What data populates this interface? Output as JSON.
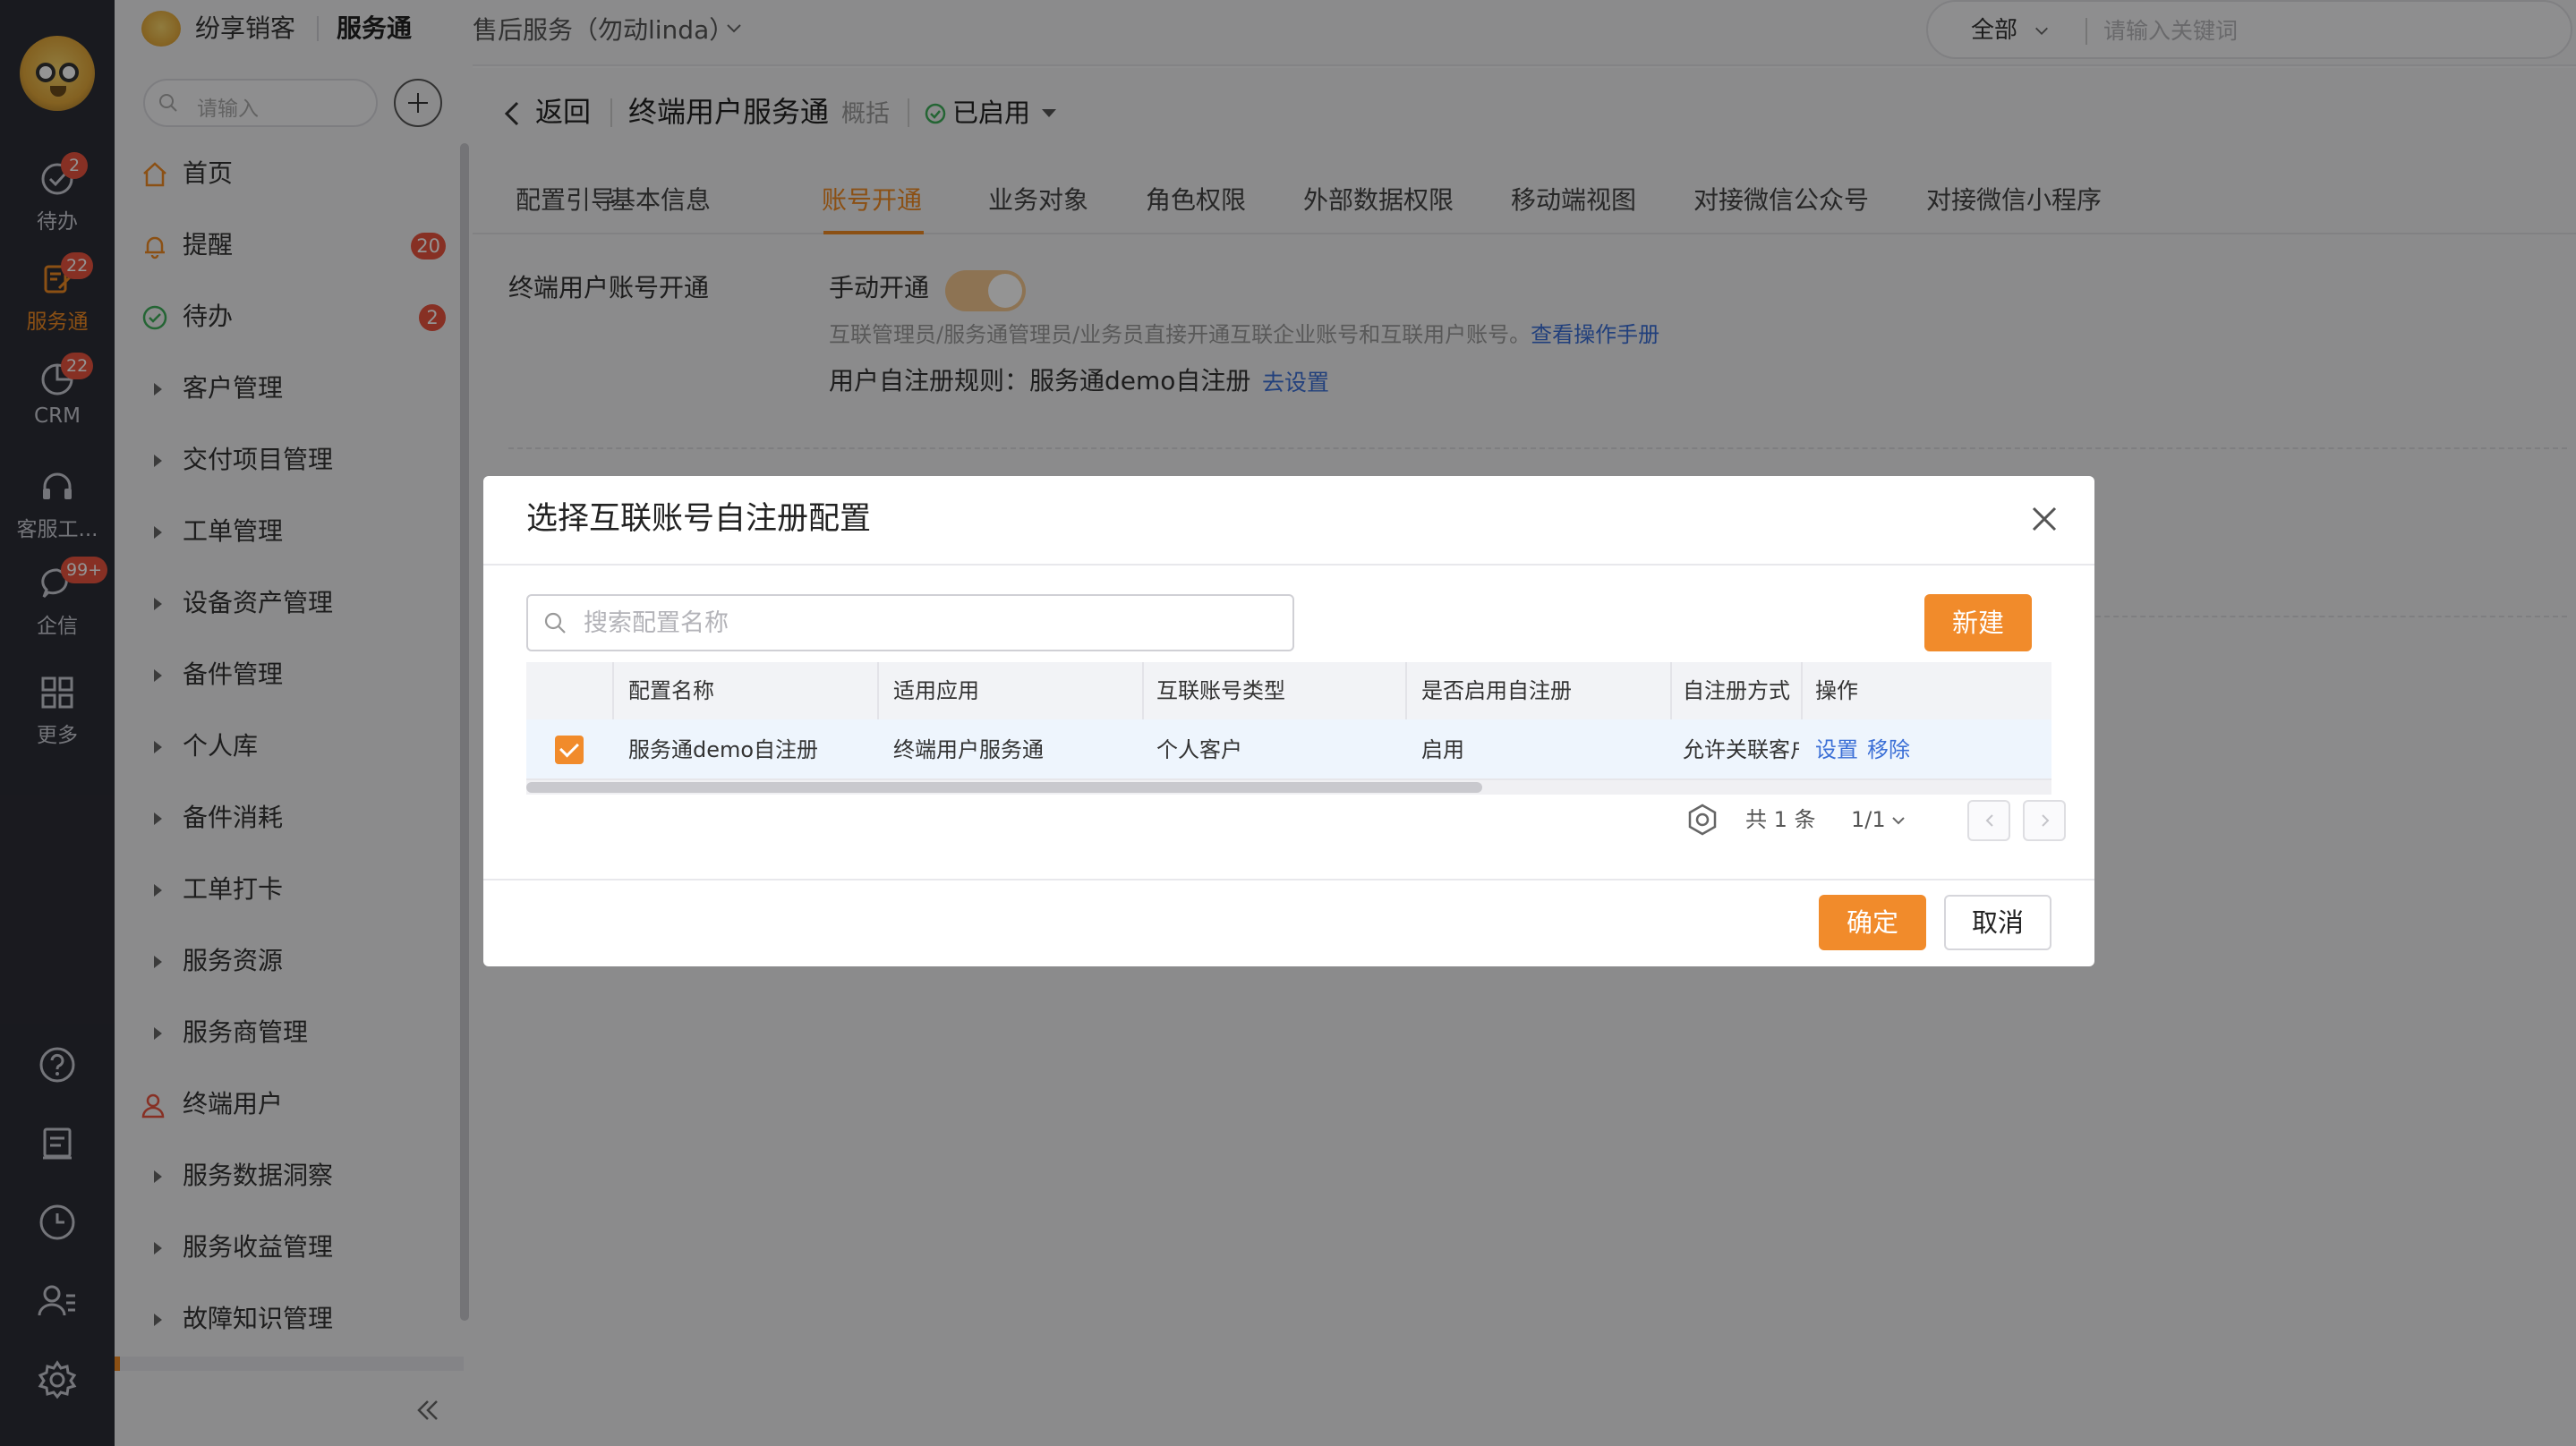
{
  "rail": {
    "items": [
      {
        "label": "待办",
        "badge": "2",
        "icon": "check-circle-icon"
      },
      {
        "label": "服务通",
        "badge": "22",
        "icon": "service-icon",
        "active": true
      },
      {
        "label": "CRM",
        "badge": "22",
        "icon": "pie-chart-icon"
      },
      {
        "label": "客服工...",
        "icon": "headset-icon"
      },
      {
        "label": "企信",
        "badge": "99+",
        "icon": "chat-bubble-icon"
      },
      {
        "label": "更多",
        "icon": "grid-icon"
      }
    ],
    "tools": [
      "help-icon",
      "document-icon",
      "clock-icon",
      "contacts-icon",
      "settings-icon"
    ]
  },
  "brand": {
    "name": "纷享销客",
    "app": "服务通"
  },
  "topbar": {
    "breadcrumb": "售后服务（勿动linda）",
    "search_scope": "全部",
    "search_placeholder": "请输入关键词"
  },
  "sidebar": {
    "search_placeholder": "请输入",
    "items": [
      {
        "label": "首页",
        "icon": "home-icon"
      },
      {
        "label": "提醒",
        "icon": "bell-icon",
        "badge": "20"
      },
      {
        "label": "待办",
        "icon": "check-circle-icon",
        "badge": "2"
      },
      {
        "label": "客户管理"
      },
      {
        "label": "交付项目管理"
      },
      {
        "label": "工单管理"
      },
      {
        "label": "设备资产管理"
      },
      {
        "label": "备件管理"
      },
      {
        "label": "个人库"
      },
      {
        "label": "备件消耗"
      },
      {
        "label": "工单打卡"
      },
      {
        "label": "服务资源"
      },
      {
        "label": "服务商管理"
      },
      {
        "label": "终端用户",
        "icon": "user-icon"
      },
      {
        "label": "服务数据洞察"
      },
      {
        "label": "服务收益管理"
      },
      {
        "label": "故障知识管理"
      }
    ]
  },
  "page": {
    "back": "返回",
    "title": "终端用户服务通",
    "subtitle": "概括",
    "status": "已启用",
    "tabs": [
      "配置引导",
      "基本信息",
      "账号开通",
      "业务对象",
      "角色权限",
      "外部数据权限",
      "移动端视图",
      "对接微信公众号",
      "对接微信小程序"
    ],
    "active_tab": "账号开通",
    "section_label": "终端用户账号开通",
    "manual_label": "手动开通",
    "manual_enabled": true,
    "desc": "互联管理员/服务通管理员/业务员直接开通互联企业账号和互联用户账号。",
    "desc_link": "查看操作手册",
    "rule_label": "用户自注册规则：服务通demo自注册",
    "rule_link": "去设置"
  },
  "modal": {
    "title": "选择互联账号自注册配置",
    "search_placeholder": "搜索配置名称",
    "new_button": "新建",
    "columns": [
      "配置名称",
      "适用应用",
      "互联账号类型",
      "是否启用自注册",
      "自注册方式",
      "操作"
    ],
    "rows": [
      {
        "name": "服务通demo自注册",
        "app": "终端用户服务通",
        "type": "个人客户",
        "enabled": "启用",
        "method": "允许关联客户",
        "action_set": "设置",
        "action_remove": "移除",
        "checked": true
      }
    ],
    "total": "共 1 条",
    "page": "1/1",
    "ok": "确定",
    "cancel": "取消"
  },
  "colors": {
    "accent": "#f08a24",
    "link": "#3b6fd6",
    "badge": "#e8533f",
    "rail": "#2c2d36"
  }
}
